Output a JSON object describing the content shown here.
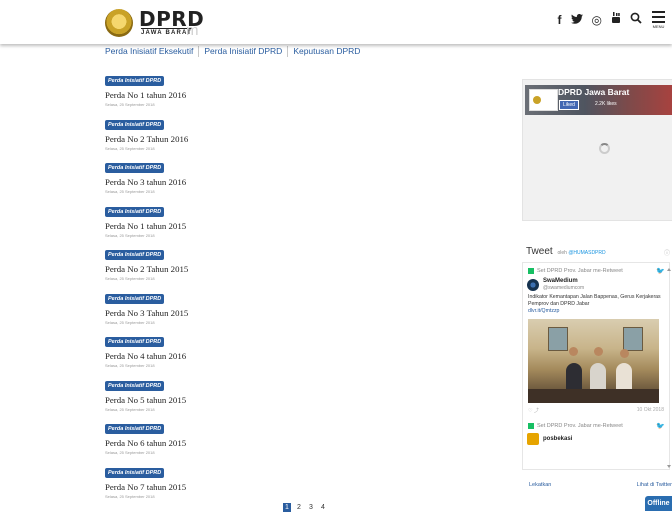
{
  "header": {
    "brand": "DPRD",
    "brand_sub": "JAWA BARAT",
    "brand_ghost": "m",
    "icons": [
      "facebook-icon",
      "twitter-icon",
      "instagram-icon",
      "youtube-icon",
      "search-icon",
      "menu-icon"
    ],
    "icon_glyphs": {
      "facebook": "f",
      "twitter": "🐦",
      "instagram": "◎",
      "youtube": "▶",
      "search": "Q"
    },
    "menu_label": "MENU"
  },
  "tabs": [
    "Perda Inisiatif Eksekutif",
    "Perda Inisiatif DPRD",
    "Keputusan DPRD"
  ],
  "items": [
    {
      "badge": "Perda Inisiatif DPRD",
      "title": "Perda No 1 tahun 2016",
      "date": "Selasa, 25 September 2018"
    },
    {
      "badge": "Perda Inisiatif DPRD",
      "title": "Perda No 2 Tahun 2016",
      "date": "Selasa, 25 September 2018"
    },
    {
      "badge": "Perda Inisiatif DPRD",
      "title": "Perda No 3 tahun 2016",
      "date": "Selasa, 25 September 2018"
    },
    {
      "badge": "Perda Inisiatif DPRD",
      "title": "Perda No 1 tahun 2015",
      "date": "Selasa, 25 September 2018"
    },
    {
      "badge": "Perda Inisiatif DPRD",
      "title": "Perda No 2 Tahun 2015",
      "date": "Selasa, 25 September 2018"
    },
    {
      "badge": "Perda Inisiatif DPRD",
      "title": "Perda No 3 Tahun 2015",
      "date": "Selasa, 25 September 2018"
    },
    {
      "badge": "Perda Inisiatif DPRD",
      "title": "Perda No 4 tahun 2016",
      "date": "Selasa, 25 September 2018"
    },
    {
      "badge": "Perda Inisiatif DPRD",
      "title": "Perda No 5 tahun 2015",
      "date": "Selasa, 25 September 2018"
    },
    {
      "badge": "Perda Inisiatif DPRD",
      "title": "Perda No 6 tahun 2015",
      "date": "Selasa, 25 September 2018"
    },
    {
      "badge": "Perda Inisiatif DPRD",
      "title": "Perda No 7 tahun 2015",
      "date": "Selasa, 25 September 2018"
    }
  ],
  "pagination": {
    "pages": [
      "1",
      "2",
      "3",
      "4"
    ],
    "active": "1"
  },
  "facebook": {
    "page_name": "DPRD Jawa Barat",
    "like_label": "Liked",
    "like_count": "2.2K likes"
  },
  "twitter": {
    "heading": "Tweet",
    "by": "oleh",
    "handle": "@HUMASDPRD",
    "retweet_label": "Set DPRD Prov. Jabar me-Retweet",
    "author_name": "SwaMedium",
    "author_handle": "@swamediumcom",
    "tweet_text": "Indikator Kemantapan Jalan Bappenas, Gerus Kerjakeras Pemprov dan DPRD Jabar",
    "tweet_link": "dlvr.it/Qmtzzp",
    "tweet_date": "10 Okt 2018",
    "retweet_label_2": "Set DPRD Prov. Jabar me-Retweet",
    "author_name_2": "posbekasi",
    "embed_label": "Lekatkan",
    "view_label": "Lihat di Twitter"
  },
  "offline_label": "Offline",
  "colors": {
    "accent": "#2a5d9f",
    "badge": "#2a5d9f",
    "offline": "#2a6db0"
  }
}
